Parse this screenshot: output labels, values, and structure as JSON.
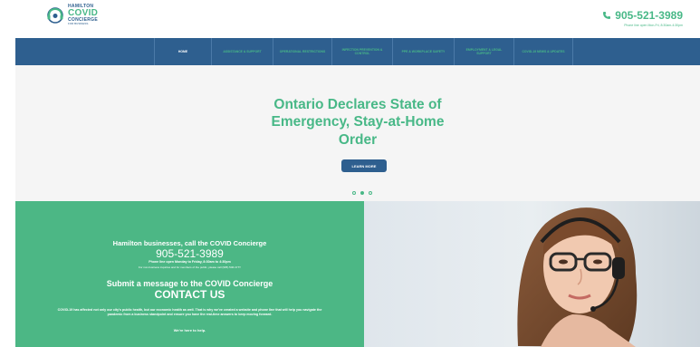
{
  "header": {
    "logo": {
      "line1": "HAMILTON",
      "line2": "COVID",
      "line3": "CONCIERGE",
      "line4": "FOR BUSINESS"
    },
    "phone": "905-521-3989",
    "phone_hours": "Phone line open Mon-Fri, 8:30am-4:30pm",
    "phone_icon": "phone-icon"
  },
  "nav": {
    "items": [
      {
        "label": "HOME",
        "active": true
      },
      {
        "label": "ASSISTANCE & SUPPORT",
        "active": false
      },
      {
        "label": "OPERATIONAL RESTRICTIONS",
        "active": false
      },
      {
        "label": "INFECTION PREVENTION & CONTROL",
        "active": false
      },
      {
        "label": "PPE & WORKPLACE SAFETY",
        "active": false
      },
      {
        "label": "EMPLOYMENT & LEGAL SUPPORT",
        "active": false
      },
      {
        "label": "COVID-19 NEWS & UPDATES",
        "active": false
      }
    ]
  },
  "hero": {
    "title_lines": [
      "Ontario Declares State of",
      "Emergency, Stay-at-Home",
      "Order"
    ],
    "button": "LEARN MORE",
    "slides": 3,
    "active_slide": 2
  },
  "info": {
    "heading": "Hamilton businesses, call the COVID Concierge",
    "phone": "905-521-3989",
    "hours": "Phone line open Monday to Friday, 8:30am to 4:30pm",
    "non_business": "For non-business inquiries and for members of the public, please call (905) 546-CITY",
    "submit": "Submit a message to the COVID Concierge",
    "contact": "CONTACT US",
    "body": "COVID-19 has affected not only our city's public health, but our economic health as well. That is why we've created a website and phone line that will help you navigate the pandemic from a business standpoint and ensure you have the real-time answers to keep moving forward.",
    "help": "We're here to help."
  },
  "colors": {
    "green": "#48b887",
    "blue": "#2e5f8f",
    "hero_bg": "#f5f5f5"
  }
}
